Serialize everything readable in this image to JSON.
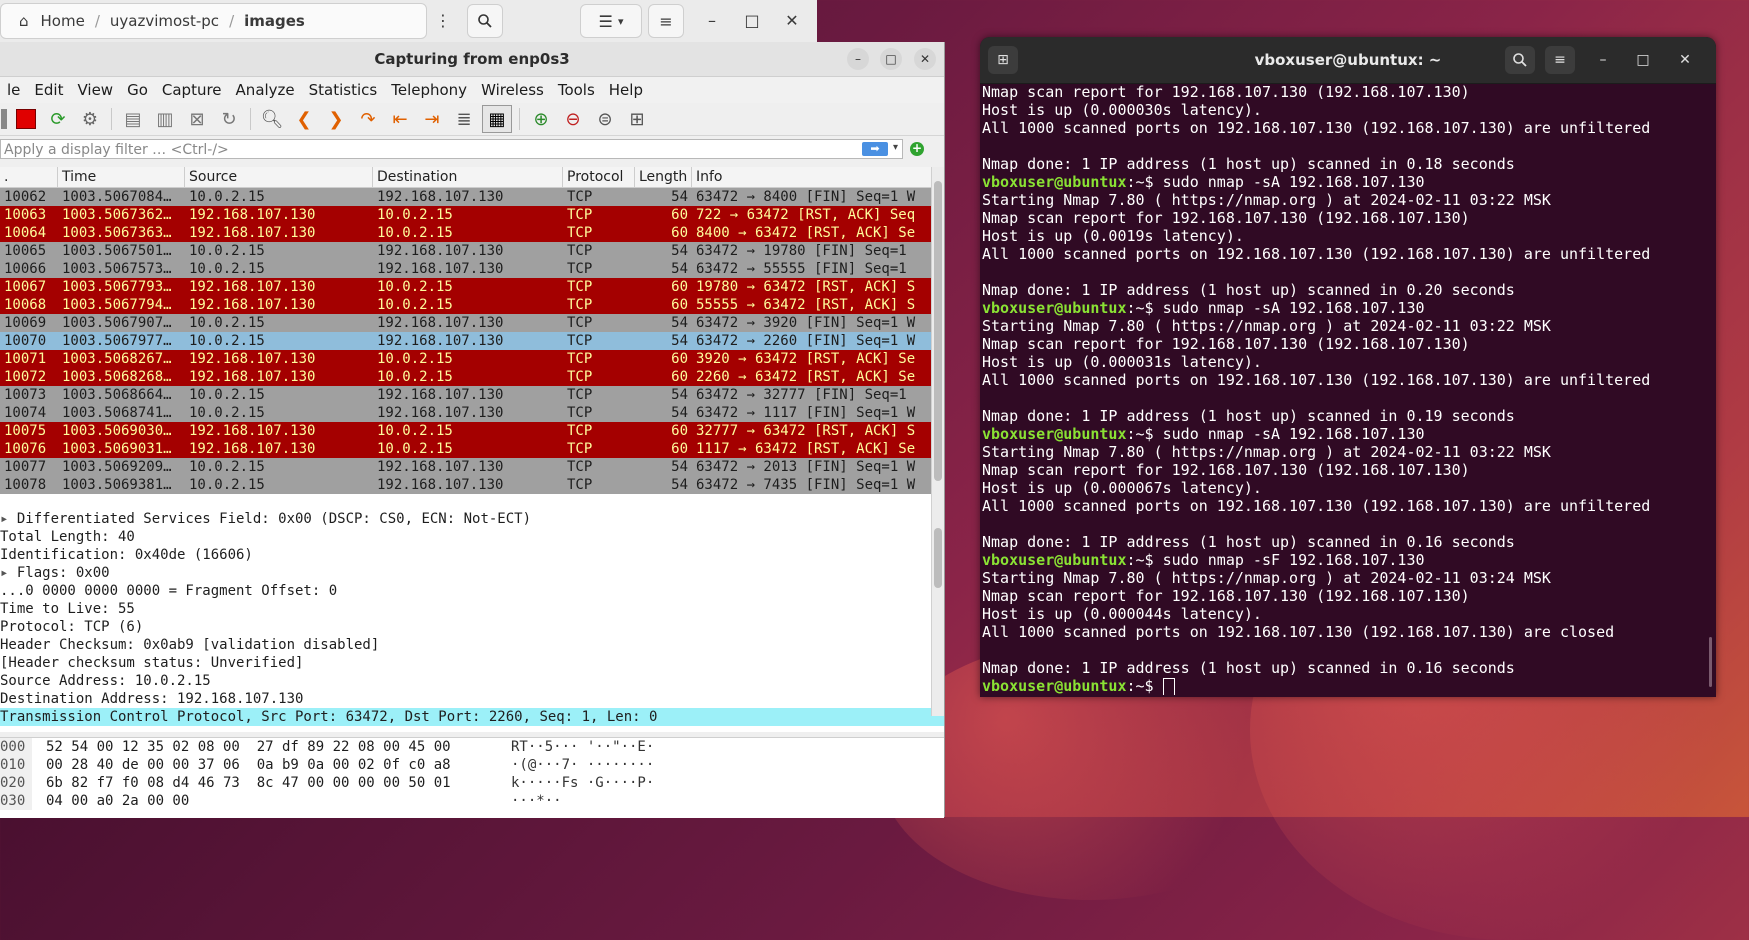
{
  "filemanager": {
    "home": "Home",
    "crumb1": "uyazvimost-pc",
    "crumb2": "images"
  },
  "wireshark": {
    "title": "Capturing from enp0s3",
    "menu": [
      "le",
      "Edit",
      "View",
      "Go",
      "Capture",
      "Analyze",
      "Statistics",
      "Telephony",
      "Wireless",
      "Tools",
      "Help"
    ],
    "filter_placeholder": "Apply a display filter … <Ctrl-/>",
    "columns": [
      ".",
      "Time",
      "Source",
      "Destination",
      "Protocol",
      "Length",
      "Info"
    ],
    "packets": [
      {
        "no": "10062",
        "time": "1003.5067084…",
        "src": "10.0.2.15",
        "dst": "192.168.107.130",
        "proto": "TCP",
        "len": "54",
        "info": "63472 → 8400 [FIN] Seq=1 W",
        "style": "gray"
      },
      {
        "no": "10063",
        "time": "1003.5067362…",
        "src": "192.168.107.130",
        "dst": "10.0.2.15",
        "proto": "TCP",
        "len": "60",
        "info": "722 → 63472 [RST, ACK] Seq",
        "style": "red"
      },
      {
        "no": "10064",
        "time": "1003.5067363…",
        "src": "192.168.107.130",
        "dst": "10.0.2.15",
        "proto": "TCP",
        "len": "60",
        "info": "8400 → 63472 [RST, ACK] Se",
        "style": "red"
      },
      {
        "no": "10065",
        "time": "1003.5067501…",
        "src": "10.0.2.15",
        "dst": "192.168.107.130",
        "proto": "TCP",
        "len": "54",
        "info": "63472 → 19780 [FIN] Seq=1",
        "style": "gray"
      },
      {
        "no": "10066",
        "time": "1003.5067573…",
        "src": "10.0.2.15",
        "dst": "192.168.107.130",
        "proto": "TCP",
        "len": "54",
        "info": "63472 → 55555 [FIN] Seq=1",
        "style": "gray"
      },
      {
        "no": "10067",
        "time": "1003.5067793…",
        "src": "192.168.107.130",
        "dst": "10.0.2.15",
        "proto": "TCP",
        "len": "60",
        "info": "19780 → 63472 [RST, ACK] S",
        "style": "red"
      },
      {
        "no": "10068",
        "time": "1003.5067794…",
        "src": "192.168.107.130",
        "dst": "10.0.2.15",
        "proto": "TCP",
        "len": "60",
        "info": "55555 → 63472 [RST, ACK] S",
        "style": "red"
      },
      {
        "no": "10069",
        "time": "1003.5067907…",
        "src": "10.0.2.15",
        "dst": "192.168.107.130",
        "proto": "TCP",
        "len": "54",
        "info": "63472 → 3920 [FIN] Seq=1 W",
        "style": "gray"
      },
      {
        "no": "10070",
        "time": "1003.5067977…",
        "src": "10.0.2.15",
        "dst": "192.168.107.130",
        "proto": "TCP",
        "len": "54",
        "info": "63472 → 2260 [FIN] Seq=1 W",
        "style": "sel"
      },
      {
        "no": "10071",
        "time": "1003.5068267…",
        "src": "192.168.107.130",
        "dst": "10.0.2.15",
        "proto": "TCP",
        "len": "60",
        "info": "3920 → 63472 [RST, ACK] Se",
        "style": "red"
      },
      {
        "no": "10072",
        "time": "1003.5068268…",
        "src": "192.168.107.130",
        "dst": "10.0.2.15",
        "proto": "TCP",
        "len": "60",
        "info": "2260 → 63472 [RST, ACK] Se",
        "style": "red"
      },
      {
        "no": "10073",
        "time": "1003.5068664…",
        "src": "10.0.2.15",
        "dst": "192.168.107.130",
        "proto": "TCP",
        "len": "54",
        "info": "63472 → 32777 [FIN] Seq=1",
        "style": "gray"
      },
      {
        "no": "10074",
        "time": "1003.5068741…",
        "src": "10.0.2.15",
        "dst": "192.168.107.130",
        "proto": "TCP",
        "len": "54",
        "info": "63472 → 1117 [FIN] Seq=1 W",
        "style": "gray"
      },
      {
        "no": "10075",
        "time": "1003.5069030…",
        "src": "192.168.107.130",
        "dst": "10.0.2.15",
        "proto": "TCP",
        "len": "60",
        "info": "32777 → 63472 [RST, ACK] S",
        "style": "red"
      },
      {
        "no": "10076",
        "time": "1003.5069031…",
        "src": "192.168.107.130",
        "dst": "10.0.2.15",
        "proto": "TCP",
        "len": "60",
        "info": "1117 → 63472 [RST, ACK] Se",
        "style": "red"
      },
      {
        "no": "10077",
        "time": "1003.5069209…",
        "src": "10.0.2.15",
        "dst": "192.168.107.130",
        "proto": "TCP",
        "len": "54",
        "info": "63472 → 2013 [FIN] Seq=1 W",
        "style": "gray"
      },
      {
        "no": "10078",
        "time": "1003.5069381…",
        "src": "10.0.2.15",
        "dst": "192.168.107.130",
        "proto": "TCP",
        "len": "54",
        "info": "63472 → 7435 [FIN] Seq=1 W",
        "style": "gray"
      }
    ],
    "details": [
      {
        "text": "Differentiated Services Field: 0x00 (DSCP: CS0, ECN: Not-ECT)",
        "expander": true
      },
      {
        "text": "Total Length: 40",
        "expander": false
      },
      {
        "text": "Identification: 0x40de (16606)",
        "expander": false
      },
      {
        "text": "Flags: 0x00",
        "expander": true
      },
      {
        "text": "...0 0000 0000 0000 = Fragment Offset: 0",
        "expander": false
      },
      {
        "text": "Time to Live: 55",
        "expander": false
      },
      {
        "text": "Protocol: TCP (6)",
        "expander": false
      },
      {
        "text": "Header Checksum: 0x0ab9 [validation disabled]",
        "expander": false
      },
      {
        "text": "[Header checksum status: Unverified]",
        "expander": false
      },
      {
        "text": "Source Address: 10.0.2.15",
        "expander": false
      },
      {
        "text": "Destination Address: 192.168.107.130",
        "expander": false
      },
      {
        "text": "Transmission Control Protocol, Src Port: 63472, Dst Port: 2260, Seq: 1, Len: 0",
        "expander": false,
        "selected": true
      }
    ],
    "hex": [
      {
        "off": "000",
        "hex": "52 54 00 12 35 02 08 00  27 df 89 22 08 00 45 00",
        "ascii": "RT··5··· '··\"··E·"
      },
      {
        "off": "010",
        "hex": "00 28 40 de 00 00 37 06  0a b9 0a 00 02 0f c0 a8",
        "ascii": "·(@···7· ········"
      },
      {
        "off": "020",
        "hex": "6b 82 f7 f0 08 d4 46 73  8c 47 00 00 00 00 50 01",
        "ascii": "k·····Fs ·G····P·"
      },
      {
        "off": "030",
        "hex": "04 00 a0 2a 00 00",
        "ascii": "···*··"
      }
    ]
  },
  "terminal": {
    "title": "vboxuser@ubuntux: ~",
    "prompt": "vboxuser@ubuntux",
    "lines": [
      {
        "t": "Nmap scan report for 192.168.107.130 (192.168.107.130)"
      },
      {
        "t": "Host is up (0.000030s latency)."
      },
      {
        "t": "All 1000 scanned ports on 192.168.107.130 (192.168.107.130) are unfiltered"
      },
      {
        "t": ""
      },
      {
        "t": "Nmap done: 1 IP address (1 host up) scanned in 0.18 seconds"
      },
      {
        "p": true,
        "t": ":~$ sudo nmap -sA 192.168.107.130"
      },
      {
        "t": "Starting Nmap 7.80 ( https://nmap.org ) at 2024-02-11 03:22 MSK"
      },
      {
        "t": "Nmap scan report for 192.168.107.130 (192.168.107.130)"
      },
      {
        "t": "Host is up (0.0019s latency)."
      },
      {
        "t": "All 1000 scanned ports on 192.168.107.130 (192.168.107.130) are unfiltered"
      },
      {
        "t": ""
      },
      {
        "t": "Nmap done: 1 IP address (1 host up) scanned in 0.20 seconds"
      },
      {
        "p": true,
        "t": ":~$ sudo nmap -sA 192.168.107.130"
      },
      {
        "t": "Starting Nmap 7.80 ( https://nmap.org ) at 2024-02-11 03:22 MSK"
      },
      {
        "t": "Nmap scan report for 192.168.107.130 (192.168.107.130)"
      },
      {
        "t": "Host is up (0.000031s latency)."
      },
      {
        "t": "All 1000 scanned ports on 192.168.107.130 (192.168.107.130) are unfiltered"
      },
      {
        "t": ""
      },
      {
        "t": "Nmap done: 1 IP address (1 host up) scanned in 0.19 seconds"
      },
      {
        "p": true,
        "t": ":~$ sudo nmap -sA 192.168.107.130"
      },
      {
        "t": "Starting Nmap 7.80 ( https://nmap.org ) at 2024-02-11 03:22 MSK"
      },
      {
        "t": "Nmap scan report for 192.168.107.130 (192.168.107.130)"
      },
      {
        "t": "Host is up (0.000067s latency)."
      },
      {
        "t": "All 1000 scanned ports on 192.168.107.130 (192.168.107.130) are unfiltered"
      },
      {
        "t": ""
      },
      {
        "t": "Nmap done: 1 IP address (1 host up) scanned in 0.16 seconds"
      },
      {
        "p": true,
        "t": ":~$ sudo nmap -sF 192.168.107.130"
      },
      {
        "t": "Starting Nmap 7.80 ( https://nmap.org ) at 2024-02-11 03:24 MSK"
      },
      {
        "t": "Nmap scan report for 192.168.107.130 (192.168.107.130)"
      },
      {
        "t": "Host is up (0.000044s latency)."
      },
      {
        "t": "All 1000 scanned ports on 192.168.107.130 (192.168.107.130) are closed"
      },
      {
        "t": ""
      },
      {
        "t": "Nmap done: 1 IP address (1 host up) scanned in 0.16 seconds"
      },
      {
        "p": true,
        "t": ":~$ ",
        "cursor": true
      }
    ]
  },
  "colors": {
    "row_red": "#a40000",
    "row_red_text": "#fffc9c",
    "row_gray": "#a0a0a0",
    "row_selected": "#8fbddb",
    "detail_selected": "#9cf0f8",
    "terminal_bg": "#300a24",
    "prompt": "#8ae234"
  }
}
